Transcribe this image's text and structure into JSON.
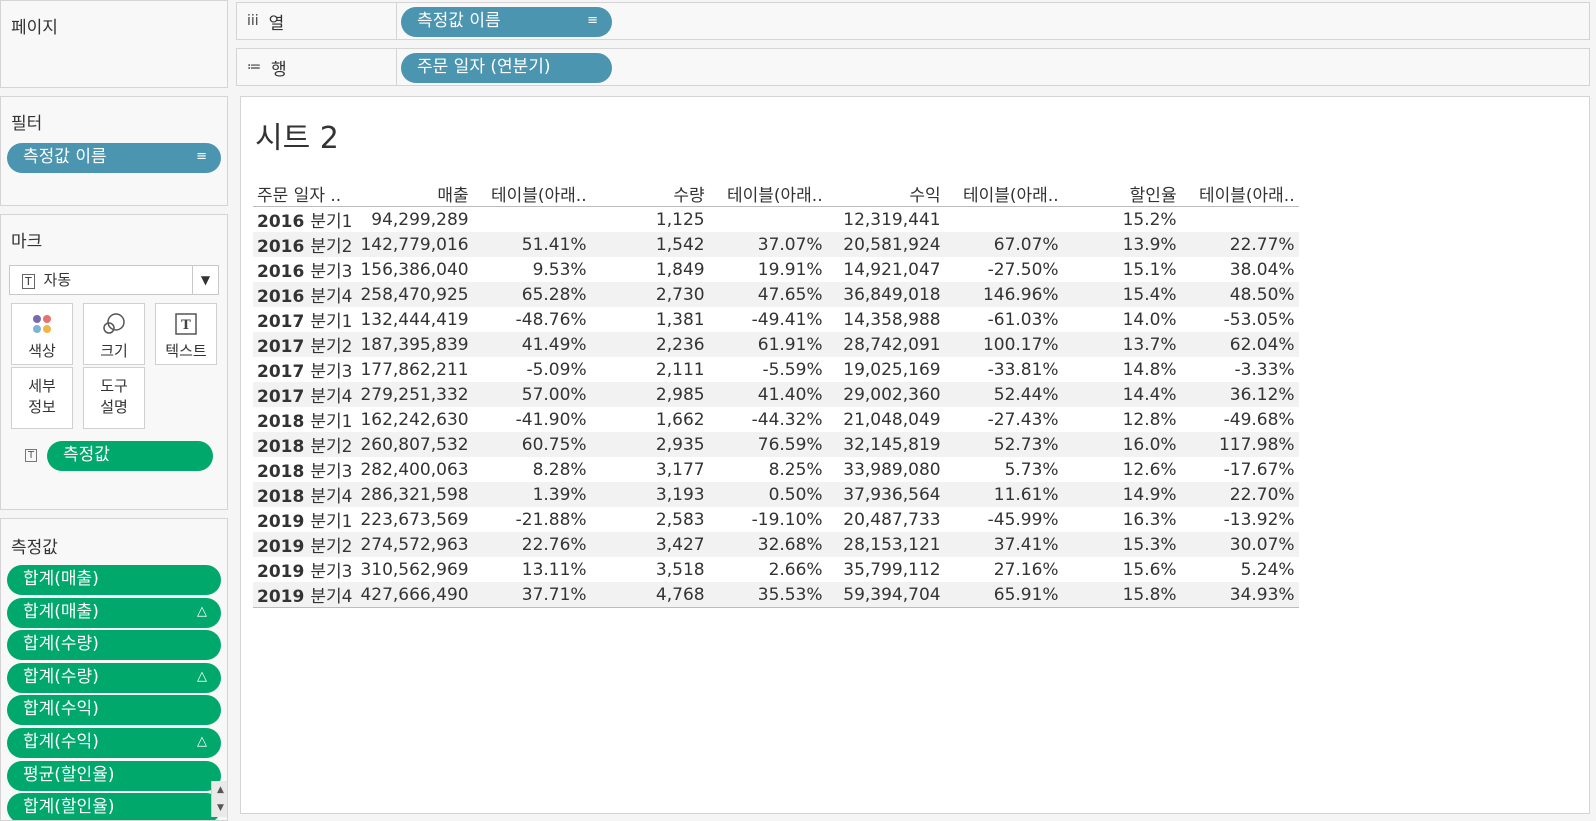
{
  "left": {
    "pages_title": "페이지",
    "filters_title": "필터",
    "filter_pill": "측정값 이름",
    "marks_title": "마크",
    "mark_type": "자동",
    "mark_cards": [
      {
        "label": "색상",
        "icon": "color-dots-icon"
      },
      {
        "label": "크기",
        "icon": "size-circles-icon"
      },
      {
        "label": "텍스트",
        "icon": "text-t-icon"
      },
      {
        "label": "세부\n정보",
        "icon": "detail-icon"
      },
      {
        "label": "도구\n설명",
        "icon": "tooltip-icon"
      }
    ],
    "marks_pill": "측정값",
    "measures_title": "측정값",
    "measures": [
      {
        "label": "합계(매출)",
        "delta": false
      },
      {
        "label": "합계(매출)",
        "delta": true
      },
      {
        "label": "합계(수량)",
        "delta": false
      },
      {
        "label": "합계(수량)",
        "delta": true
      },
      {
        "label": "합계(수익)",
        "delta": false
      },
      {
        "label": "합계(수익)",
        "delta": true
      },
      {
        "label": "평균(할인율)",
        "delta": false
      },
      {
        "label": "합계(할인율)",
        "delta": false
      }
    ],
    "delta_glyph": "△"
  },
  "shelves": {
    "columns_label": "열",
    "columns_pill": "측정값 이름",
    "rows_label": "행",
    "rows_pill": "주문 일자 (연분기)"
  },
  "sheet": {
    "title": "시트 2",
    "headers": [
      "주문 일자 ..",
      "매출",
      "테이블(아래..",
      "수량",
      "테이블(아래..",
      "수익",
      "테이블(아래..",
      "할인율",
      "테이블(아래.."
    ],
    "rows": [
      {
        "year": "2016",
        "q": "분기1",
        "cells": [
          "94,299,289",
          "",
          "1,125",
          "",
          "12,319,441",
          "",
          "15.2%",
          ""
        ]
      },
      {
        "year": "2016",
        "q": "분기2",
        "cells": [
          "142,779,016",
          "51.41%",
          "1,542",
          "37.07%",
          "20,581,924",
          "67.07%",
          "13.9%",
          "22.77%"
        ]
      },
      {
        "year": "2016",
        "q": "분기3",
        "cells": [
          "156,386,040",
          "9.53%",
          "1,849",
          "19.91%",
          "14,921,047",
          "-27.50%",
          "15.1%",
          "38.04%"
        ]
      },
      {
        "year": "2016",
        "q": "분기4",
        "cells": [
          "258,470,925",
          "65.28%",
          "2,730",
          "47.65%",
          "36,849,018",
          "146.96%",
          "15.4%",
          "48.50%"
        ]
      },
      {
        "year": "2017",
        "q": "분기1",
        "cells": [
          "132,444,419",
          "-48.76%",
          "1,381",
          "-49.41%",
          "14,358,988",
          "-61.03%",
          "14.0%",
          "-53.05%"
        ]
      },
      {
        "year": "2017",
        "q": "분기2",
        "cells": [
          "187,395,839",
          "41.49%",
          "2,236",
          "61.91%",
          "28,742,091",
          "100.17%",
          "13.7%",
          "62.04%"
        ]
      },
      {
        "year": "2017",
        "q": "분기3",
        "cells": [
          "177,862,211",
          "-5.09%",
          "2,111",
          "-5.59%",
          "19,025,169",
          "-33.81%",
          "14.8%",
          "-3.33%"
        ]
      },
      {
        "year": "2017",
        "q": "분기4",
        "cells": [
          "279,251,332",
          "57.00%",
          "2,985",
          "41.40%",
          "29,002,360",
          "52.44%",
          "14.4%",
          "36.12%"
        ]
      },
      {
        "year": "2018",
        "q": "분기1",
        "cells": [
          "162,242,630",
          "-41.90%",
          "1,662",
          "-44.32%",
          "21,048,049",
          "-27.43%",
          "12.8%",
          "-49.68%"
        ]
      },
      {
        "year": "2018",
        "q": "분기2",
        "cells": [
          "260,807,532",
          "60.75%",
          "2,935",
          "76.59%",
          "32,145,819",
          "52.73%",
          "16.0%",
          "117.98%"
        ]
      },
      {
        "year": "2018",
        "q": "분기3",
        "cells": [
          "282,400,063",
          "8.28%",
          "3,177",
          "8.25%",
          "33,989,080",
          "5.73%",
          "12.6%",
          "-17.67%"
        ]
      },
      {
        "year": "2018",
        "q": "분기4",
        "cells": [
          "286,321,598",
          "1.39%",
          "3,193",
          "0.50%",
          "37,936,564",
          "11.61%",
          "14.9%",
          "22.70%"
        ]
      },
      {
        "year": "2019",
        "q": "분기1",
        "cells": [
          "223,673,569",
          "-21.88%",
          "2,583",
          "-19.10%",
          "20,487,733",
          "-45.99%",
          "16.3%",
          "-13.92%"
        ]
      },
      {
        "year": "2019",
        "q": "분기2",
        "cells": [
          "274,572,963",
          "22.76%",
          "3,427",
          "32.68%",
          "28,153,121",
          "37.41%",
          "15.3%",
          "30.07%"
        ]
      },
      {
        "year": "2019",
        "q": "분기3",
        "cells": [
          "310,562,969",
          "13.11%",
          "3,518",
          "2.66%",
          "35,799,112",
          "27.16%",
          "15.6%",
          "5.24%"
        ]
      },
      {
        "year": "2019",
        "q": "분기4",
        "cells": [
          "427,666,490",
          "37.71%",
          "4,768",
          "35.53%",
          "59,394,704",
          "65.91%",
          "15.8%",
          "34.93%"
        ]
      }
    ]
  },
  "colors": {
    "blue_pill": "#4b95b0",
    "green_pill": "#00a86b"
  }
}
